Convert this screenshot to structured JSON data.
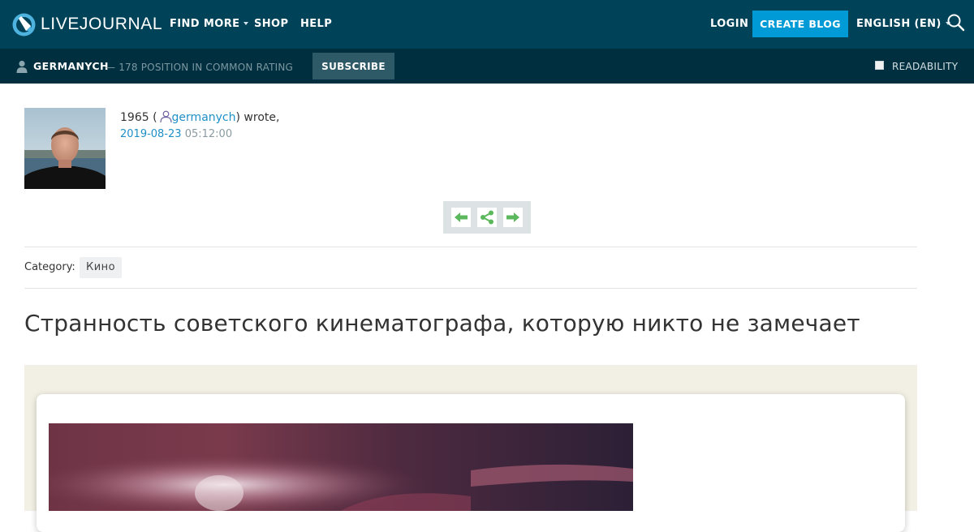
{
  "topbar": {
    "logo_text": "LIVEJOURNAL",
    "find_more": "FIND MORE",
    "shop": "SHOP",
    "help": "HELP",
    "login": "LOGIN",
    "create_blog": "CREATE BLOG",
    "language": "ENGLISH (EN)",
    "colors": {
      "background": "#004359",
      "accent": "#009bd6"
    }
  },
  "subbar": {
    "username": "GERMANYCH",
    "rating": "— 178 POSITION IN COMMON RATING",
    "subscribe": "SUBSCRIBE",
    "readability": "READABILITY",
    "background": "#003040"
  },
  "entry": {
    "author_prefix": "1965 (",
    "author": "germanych",
    "author_suffix": ") wrote,",
    "date": "2019-08-23",
    "time": "05:12:00",
    "category_label": "Category:",
    "category": "Кино",
    "title": "Странность советского кинематографа, которую никто не замечает"
  },
  "icons": {
    "logo": "livejournal-logo-icon",
    "search": "search-icon",
    "user": "user-icon",
    "prev": "arrow-left-icon",
    "share": "share-icon",
    "next": "arrow-right-icon",
    "nav_color": "#5cb85c"
  }
}
